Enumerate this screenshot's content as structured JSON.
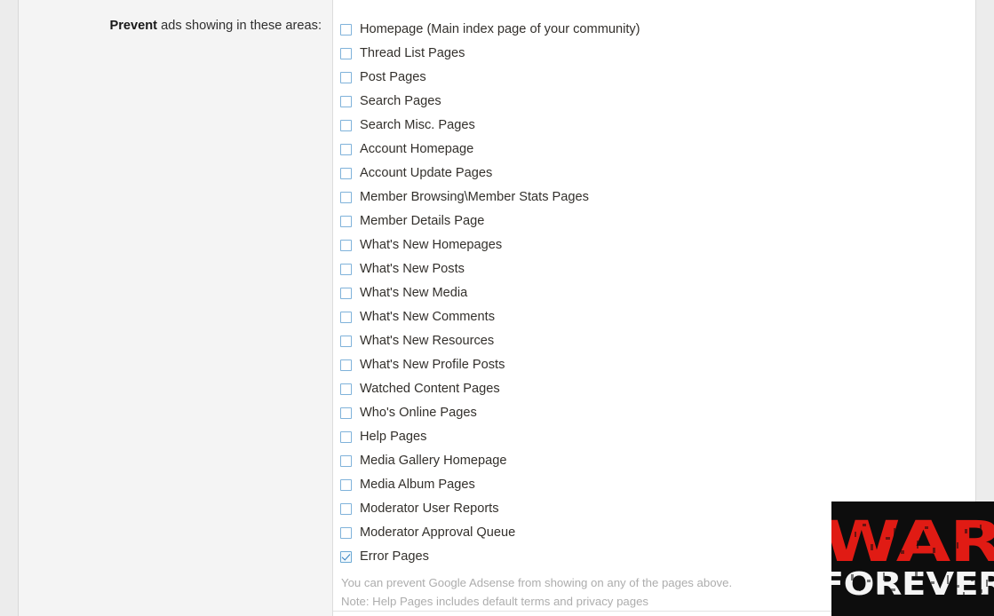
{
  "form": {
    "label_strong": "Prevent",
    "label_rest": " ads showing in these areas:"
  },
  "options": [
    {
      "label": "Homepage (Main index page of your community)",
      "checked": false
    },
    {
      "label": "Thread List Pages",
      "checked": false
    },
    {
      "label": "Post Pages",
      "checked": false
    },
    {
      "label": "Search Pages",
      "checked": false
    },
    {
      "label": "Search Misc. Pages",
      "checked": false
    },
    {
      "label": "Account Homepage",
      "checked": false
    },
    {
      "label": "Account Update Pages",
      "checked": false
    },
    {
      "label": "Member Browsing\\Member Stats Pages",
      "checked": false
    },
    {
      "label": "Member Details Page",
      "checked": false
    },
    {
      "label": "What's New Homepages",
      "checked": false
    },
    {
      "label": "What's New Posts",
      "checked": false
    },
    {
      "label": "What's New Media",
      "checked": false
    },
    {
      "label": "What's New Comments",
      "checked": false
    },
    {
      "label": "What's New Resources",
      "checked": false
    },
    {
      "label": "What's New Profile Posts",
      "checked": false
    },
    {
      "label": "Watched Content Pages",
      "checked": false
    },
    {
      "label": "Who's Online Pages",
      "checked": false
    },
    {
      "label": "Help Pages",
      "checked": false
    },
    {
      "label": "Media Gallery Homepage",
      "checked": false
    },
    {
      "label": "Media Album Pages",
      "checked": false
    },
    {
      "label": "Moderator User Reports",
      "checked": false
    },
    {
      "label": "Moderator Approval Queue",
      "checked": false
    },
    {
      "label": "Error Pages",
      "checked": true
    }
  ],
  "notes": [
    "You can prevent Google Adsense from showing on any of the pages above.",
    "Note: Help Pages includes default terms and privacy pages"
  ],
  "watermark": {
    "line1": "WAR",
    "line2": "FOREVER",
    "color_primary": "#e01b14",
    "color_secondary": "#f4f4f4",
    "background": "#0d0d0d"
  },
  "theme": {
    "checkbox_border": "#7fb2da",
    "check_color": "#2f7fc0",
    "label_color": "#33302c",
    "note_color": "#adadad",
    "panel_background": "#f4f4f4",
    "field_background": "#ffffff"
  }
}
